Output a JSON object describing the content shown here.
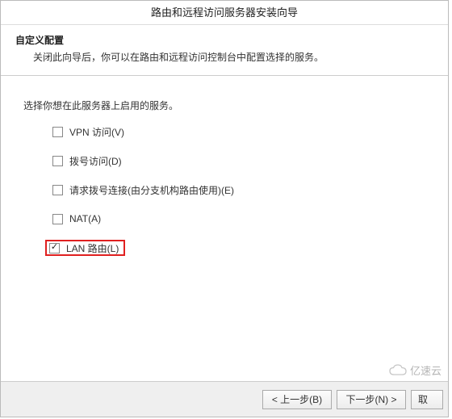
{
  "dialog": {
    "title": "路由和远程访问服务器安装向导"
  },
  "header": {
    "title": "自定义配置",
    "subtitle": "关闭此向导后，你可以在路由和远程访问控制台中配置选择的服务。"
  },
  "body": {
    "instruction": "选择你想在此服务器上启用的服务。",
    "options": [
      {
        "label": "VPN 访问(V)",
        "checked": false,
        "highlighted": false
      },
      {
        "label": "拨号访问(D)",
        "checked": false,
        "highlighted": false
      },
      {
        "label": "请求拨号连接(由分支机构路由使用)(E)",
        "checked": false,
        "highlighted": false
      },
      {
        "label": "NAT(A)",
        "checked": false,
        "highlighted": false
      },
      {
        "label": "LAN 路由(L)",
        "checked": true,
        "highlighted": true
      }
    ]
  },
  "buttons": {
    "back": "< 上一步(B)",
    "next": "下一步(N) >",
    "cancel_partial": "取"
  },
  "watermark": {
    "text": "亿速云"
  }
}
